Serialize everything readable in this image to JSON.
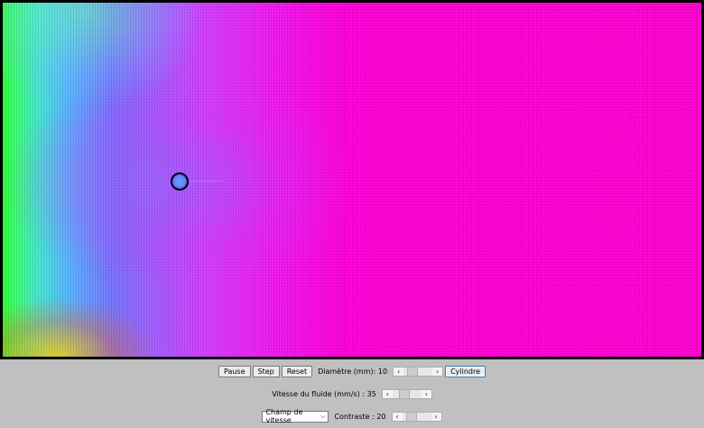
{
  "controls": {
    "pause_label": "Pause",
    "step_label": "Step",
    "reset_label": "Reset",
    "diameter_label": "Diamètre (mm): 10",
    "diameter_value": 0.18,
    "cylinder_label": "Cylindre",
    "speed_label": "Vitesse du fluide (mm/s) : 35",
    "speed_value": 0.35,
    "display_mode_selected": "Champ de vitesse",
    "contrast_label": "Contraste : 20",
    "contrast_value": 0.2
  },
  "icons": {
    "left_arrow": "‹",
    "right_arrow": "›",
    "dropdown": "⌵"
  }
}
